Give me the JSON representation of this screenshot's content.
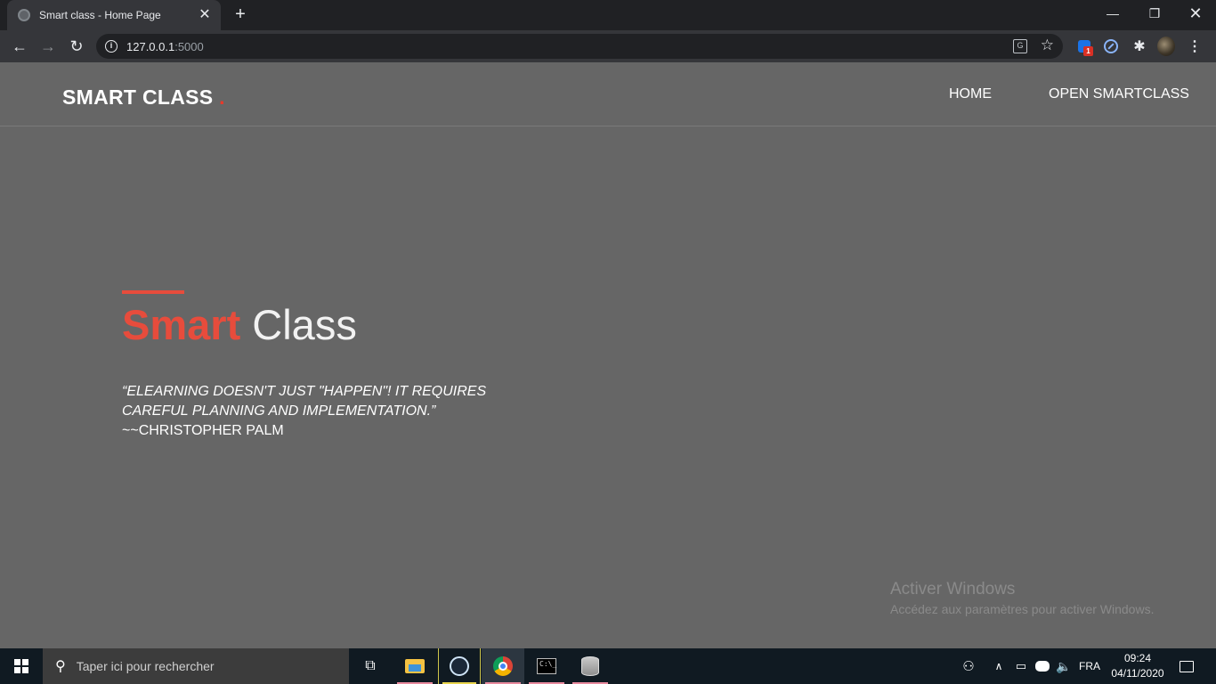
{
  "browser": {
    "tab_title": "Smart class - Home Page",
    "tab_close": "✕",
    "new_tab": "+",
    "minimize": "—",
    "maximize": "❐",
    "close": "✕",
    "back": "←",
    "forward": "→",
    "reload": "↻",
    "url_host": "127.0.0.1",
    "url_port": ":5000",
    "bookmark_star": "☆",
    "ext_badge": "1",
    "extensions_icon": "✱",
    "menu": "⋮"
  },
  "site": {
    "brand": "SMART CLASS",
    "brand_dot": ".",
    "nav": {
      "home": "HOME",
      "open": "OPEN SMARTCLASS"
    },
    "hero": {
      "title_accent": "Smart",
      "title_rest": " Class",
      "quote": "“eLearning doesn't just \"happen\"! It requires careful planning and implementation.”",
      "author": "~~CHRISTOPHER PALM"
    }
  },
  "watermark": {
    "title": "Activer Windows",
    "subtitle": "Accédez aux paramètres pour activer Windows."
  },
  "taskbar": {
    "search_placeholder": "Taper ici pour rechercher",
    "search_icon": "⚲",
    "taskview_icon": "⧉",
    "people_icon": "⚇",
    "chevron": "∧",
    "network_icon": "▭",
    "volume_icon": "🔈",
    "language": "FRA",
    "time": "09:24",
    "date": "04/11/2020"
  },
  "colors": {
    "accent_red": "#e74c3c",
    "page_bg": "#666666",
    "chrome_dark": "#202124",
    "taskbar_bg": "#101a22"
  }
}
